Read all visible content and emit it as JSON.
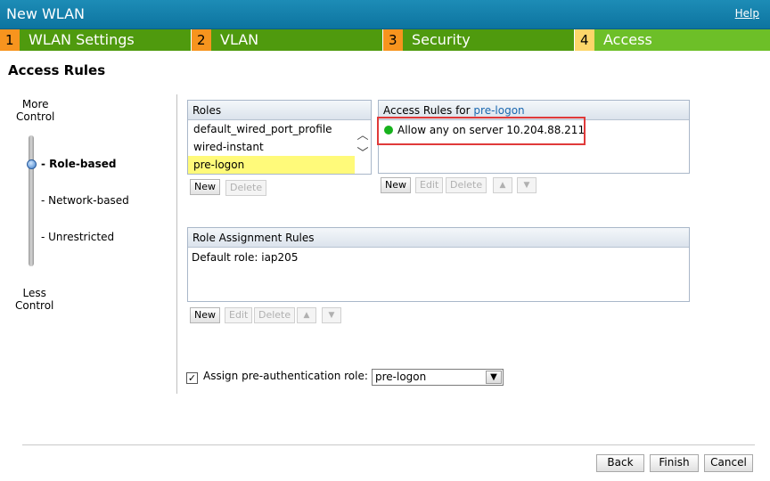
{
  "window": {
    "title": "New WLAN",
    "help_label": "Help"
  },
  "steps": [
    {
      "num": "1",
      "label": "WLAN Settings"
    },
    {
      "num": "2",
      "label": "VLAN"
    },
    {
      "num": "3",
      "label": "Security"
    },
    {
      "num": "4",
      "label": "Access"
    }
  ],
  "section_title": "Access Rules",
  "control_slider": {
    "top_label_line1": "More",
    "top_label_line2": "Control",
    "bottom_label_line1": "Less",
    "bottom_label_line2": "Control",
    "levels": [
      "- Role-based",
      "- Network-based",
      "- Unrestricted"
    ],
    "selected": "- Role-based"
  },
  "roles": {
    "header": "Roles",
    "items": [
      "default_wired_port_profile",
      "wired-instant",
      "pre-logon"
    ],
    "selected": "pre-logon",
    "new_label": "New",
    "delete_label": "Delete"
  },
  "access_rules": {
    "header_prefix": "Access Rules for ",
    "header_role": "pre-logon",
    "rules": [
      "Allow any on server 10.204.88.211"
    ],
    "status_color": "#17b21d",
    "highlight_color": "#e03a3a",
    "new_label": "New",
    "edit_label": "Edit",
    "delete_label": "Delete",
    "up_icon": "arrow-up-icon",
    "down_icon": "arrow-down-icon"
  },
  "role_assignment": {
    "header": "Role Assignment Rules",
    "rows": [
      "Default role: iap205"
    ],
    "new_label": "New",
    "edit_label": "Edit",
    "delete_label": "Delete"
  },
  "pre_auth": {
    "checked": true,
    "label": "Assign pre-authentication role:",
    "value": "pre-logon"
  },
  "footer": {
    "back_label": "Back",
    "finish_label": "Finish",
    "cancel_label": "Cancel"
  }
}
